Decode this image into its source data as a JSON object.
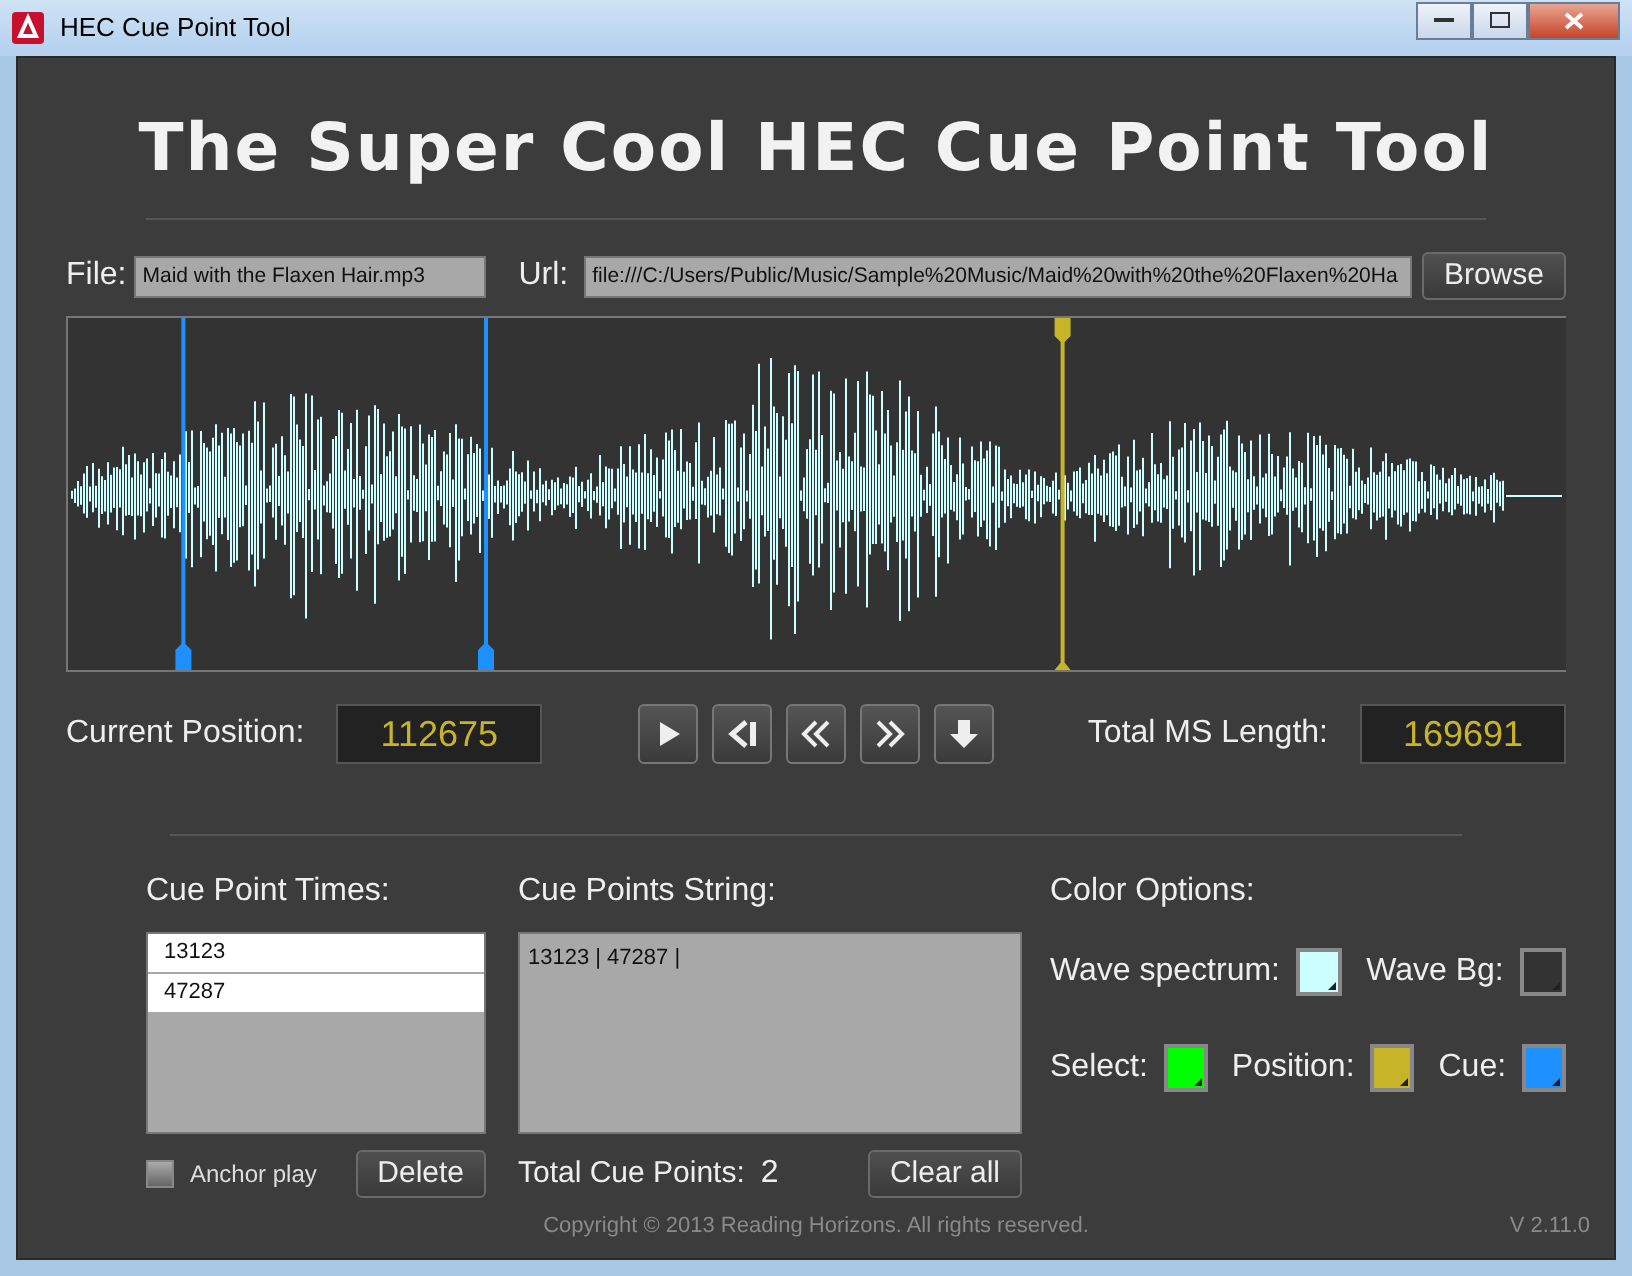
{
  "window": {
    "title": "HEC Cue Point Tool"
  },
  "heading": "The Super Cool HEC Cue Point Tool",
  "file": {
    "label": "File:",
    "value": "Maid with the Flaxen Hair.mp3"
  },
  "url": {
    "label": "Url:",
    "value": "file:///C:/Users/Public/Music/Sample%20Music/Maid%20with%20the%20Flaxen%20Ha"
  },
  "browse_button": "Browse",
  "waveform": {
    "cue_markers": [
      {
        "level": 0.077
      },
      {
        "level": 0.279
      }
    ],
    "position_marker": {
      "level": 0.664
    }
  },
  "current_position": {
    "label": "Current Position:",
    "value": "112675"
  },
  "transport_buttons": [
    {
      "kind": "play"
    },
    {
      "kind": "step-back"
    },
    {
      "kind": "rewind"
    },
    {
      "kind": "forward"
    },
    {
      "kind": "down"
    }
  ],
  "total_length": {
    "label": "Total MS Length:",
    "value": "169691"
  },
  "cue_times": {
    "label": "Cue Point Times:",
    "items": [
      "13123",
      "47287"
    ]
  },
  "cue_string": {
    "label": "Cue Points String:",
    "value": "13123 | 47287 |"
  },
  "color_options": {
    "label": "Color Options:",
    "swatches": [
      {
        "label": "Wave spectrum:",
        "color": "#ccffff"
      },
      {
        "label": "Wave Bg:",
        "color": "#333333"
      },
      {
        "label": "Select:",
        "color": "#00ff00"
      },
      {
        "label": "Position:",
        "color": "#c8b428"
      },
      {
        "label": "Cue:",
        "color": "#1e90ff"
      }
    ]
  },
  "anchor_play": {
    "label": "Anchor play",
    "checked": false
  },
  "delete_button": "Delete",
  "total_cue_points": {
    "label": "Total Cue Points:",
    "value": "2"
  },
  "clear_button": "Clear all",
  "copyright": "Copyright © 2013 Reading Horizons. All rights reserved.",
  "version": "V 2.11.0"
}
